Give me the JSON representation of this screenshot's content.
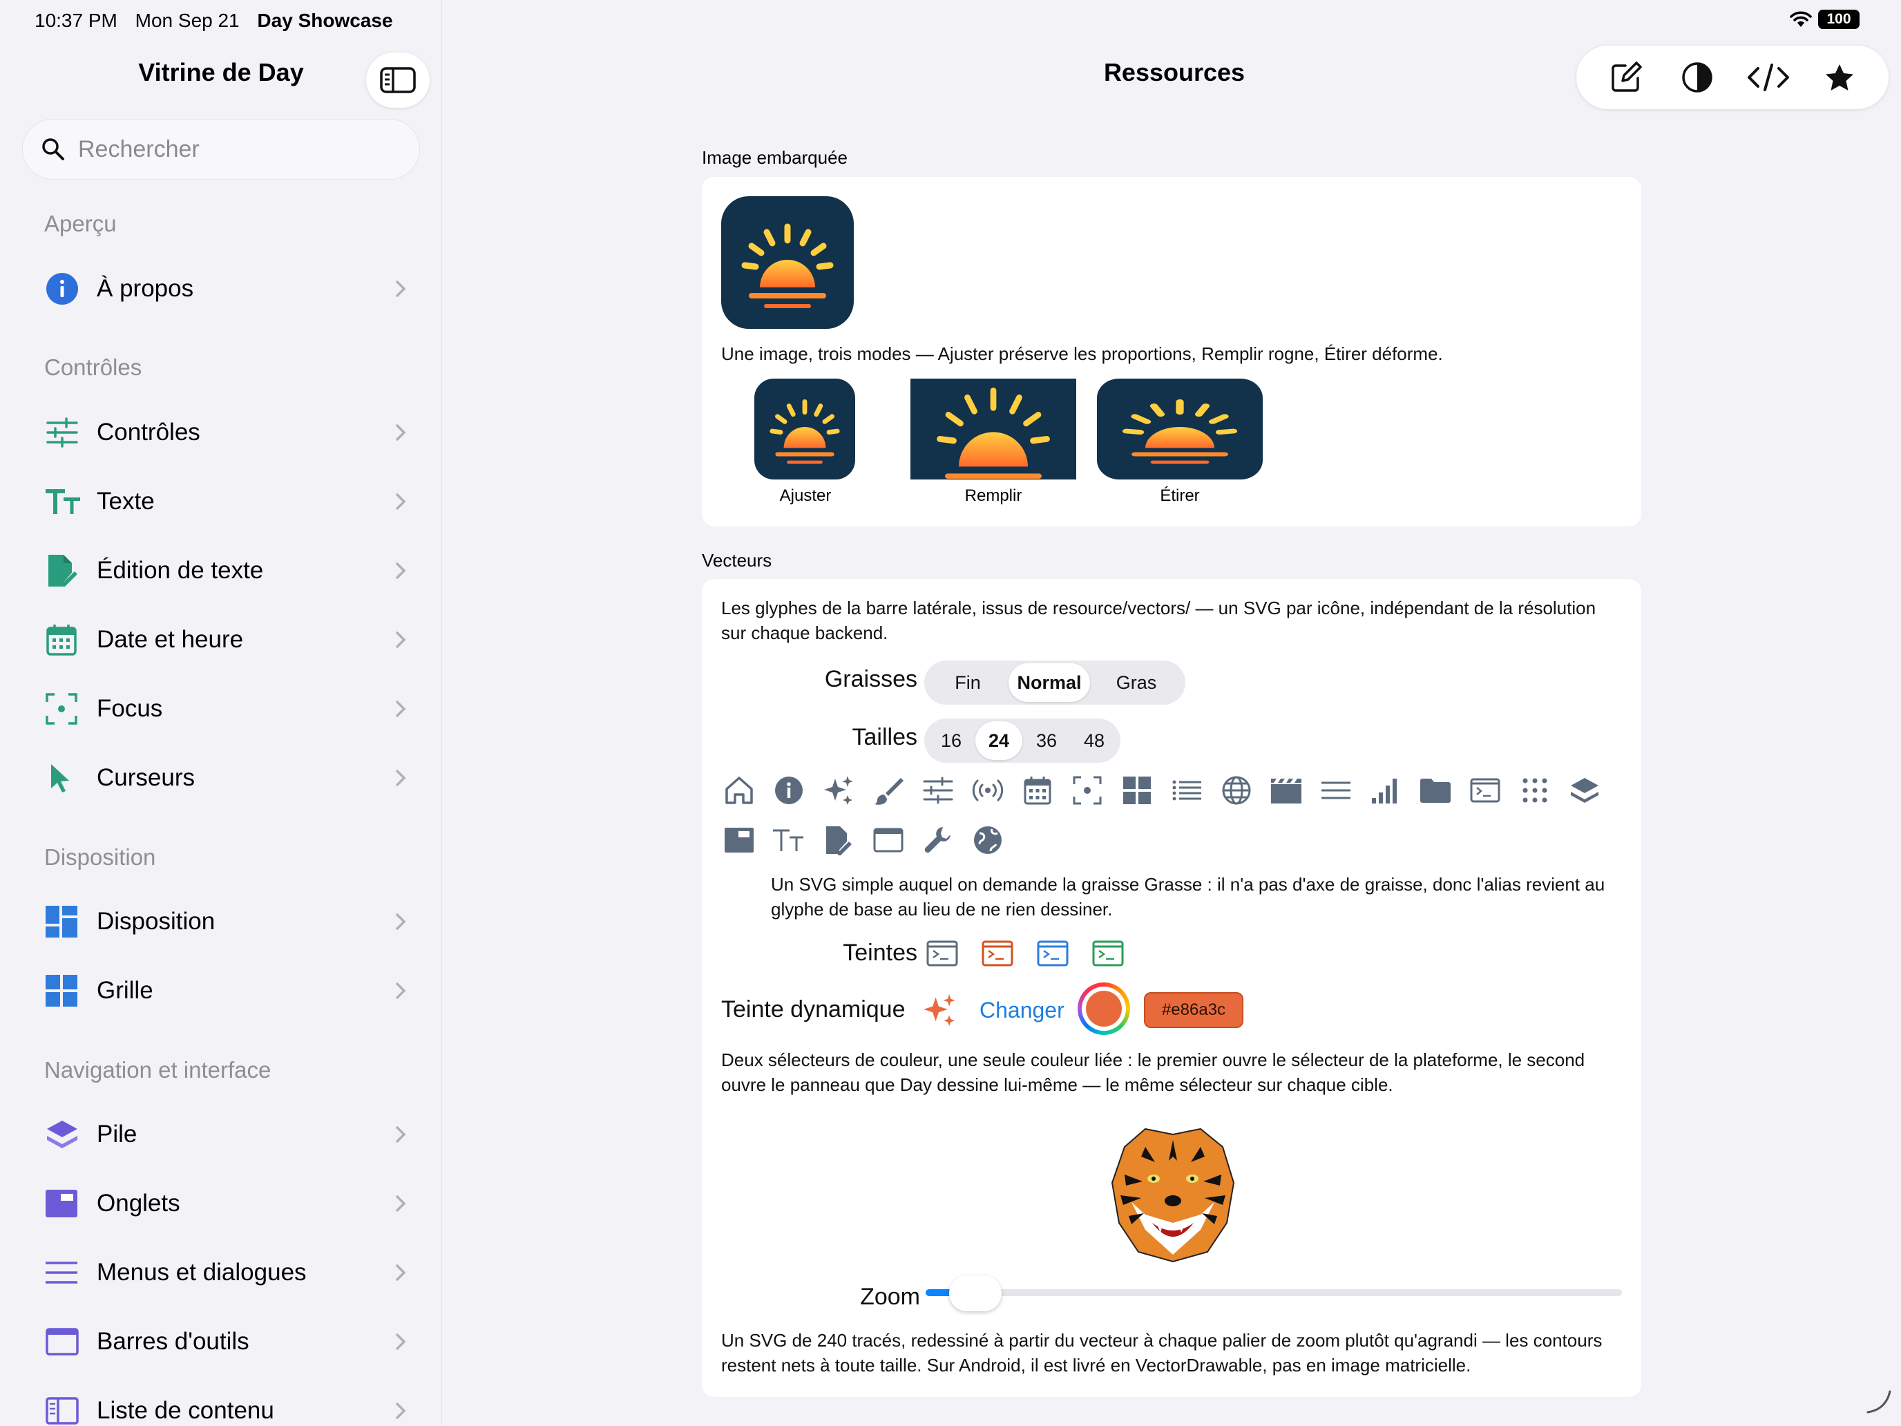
{
  "status": {
    "time": "10:37 PM",
    "date": "Mon Sep 21",
    "app": "Day Showcase",
    "battery": "100"
  },
  "sidebar": {
    "title": "Vitrine de Day",
    "search_placeholder": "Rechercher",
    "sections": [
      {
        "label": "Aperçu",
        "items": [
          {
            "label": "À propos",
            "icon": "info-icon"
          }
        ]
      },
      {
        "label": "Contrôles",
        "items": [
          {
            "label": "Contrôles",
            "icon": "sliders-icon"
          },
          {
            "label": "Texte",
            "icon": "text-size-icon"
          },
          {
            "label": "Édition de texte",
            "icon": "document-edit-icon"
          },
          {
            "label": "Date et heure",
            "icon": "calendar-icon"
          },
          {
            "label": "Focus",
            "icon": "focus-icon"
          },
          {
            "label": "Curseurs",
            "icon": "cursor-icon"
          }
        ]
      },
      {
        "label": "Disposition",
        "items": [
          {
            "label": "Disposition",
            "icon": "layout-icon"
          },
          {
            "label": "Grille",
            "icon": "grid-icon"
          }
        ]
      },
      {
        "label": "Navigation et interface",
        "items": [
          {
            "label": "Pile",
            "icon": "stack-icon"
          },
          {
            "label": "Onglets",
            "icon": "tabs-icon"
          },
          {
            "label": "Menus et dialogues",
            "icon": "menu-icon"
          },
          {
            "label": "Barres d'outils",
            "icon": "toolbar-icon"
          },
          {
            "label": "Liste de contenu",
            "icon": "list-detail-icon"
          }
        ]
      }
    ],
    "colors": {
      "teal": "#2a9d7f",
      "blue": "#2f7bdc",
      "purple": "#6b5bd6"
    }
  },
  "main": {
    "title": "Ressources",
    "toolbar": [
      "compose-icon",
      "contrast-icon",
      "code-icon",
      "star-icon"
    ],
    "embedded": {
      "label": "Image embarquée",
      "description": "Une image, trois modes — Ajuster préserve les proportions, Remplir rogne, Étirer déforme.",
      "modes": [
        "Ajuster",
        "Remplir",
        "Étirer"
      ]
    },
    "vectors": {
      "label": "Vecteurs",
      "intro": "Les glyphes de la barre latérale, issus de resource/vectors/ — un SVG par icône, indépendant de la résolution sur chaque backend.",
      "weights_label": "Graisses",
      "weights": [
        "Fin",
        "Normal",
        "Gras"
      ],
      "weights_selected": "Normal",
      "sizes_label": "Tailles",
      "sizes": [
        "16",
        "24",
        "36",
        "48"
      ],
      "sizes_selected": "24",
      "glyph_icons": [
        "home-icon",
        "info-icon",
        "sparkles-icon",
        "brush-icon",
        "sliders-icon",
        "broadcast-icon",
        "calendar-icon",
        "focus-icon",
        "grid-icon",
        "list-icon",
        "globe-icon",
        "clapperboard-icon",
        "lines-icon",
        "bars-chart-icon",
        "folder-icon",
        "terminal-icon",
        "dots-grid-icon",
        "layers-icon",
        "tabs-icon",
        "text-size-icon",
        "document-edit-icon",
        "window-icon",
        "wrench-icon",
        "globe-filled-icon"
      ],
      "weight_note": "Un SVG simple auquel on demande la graisse Grasse : il n'a pas d'axe de graisse, donc l'alias revient au glyphe de base au lieu de ne rien dessiner.",
      "tints_label": "Teintes",
      "tint_colors": [
        "#5b6b7d",
        "#d2521f",
        "#2f7bdc",
        "#2a9d5a"
      ],
      "dynamic_label": "Teinte dynamique",
      "change_label": "Changer",
      "dynamic_color": "#e86a3c",
      "hex_value": "#e86a3c",
      "pickers_note": "Deux sélecteurs de couleur, une seule couleur liée : le premier ouvre le sélecteur de la plateforme, le second ouvre le panneau que Day dessine lui-même — le même sélecteur sur chaque cible.",
      "zoom_label": "Zoom",
      "zoom_value": 0.04,
      "tiger_note": "Un SVG de 240 tracés, redessiné à partir du vecteur à chaque palier de zoom plutôt qu'agrandi — les contours restent nets à toute taille. Sur Android, il est livré en VectorDrawable, pas en image matricielle."
    }
  }
}
